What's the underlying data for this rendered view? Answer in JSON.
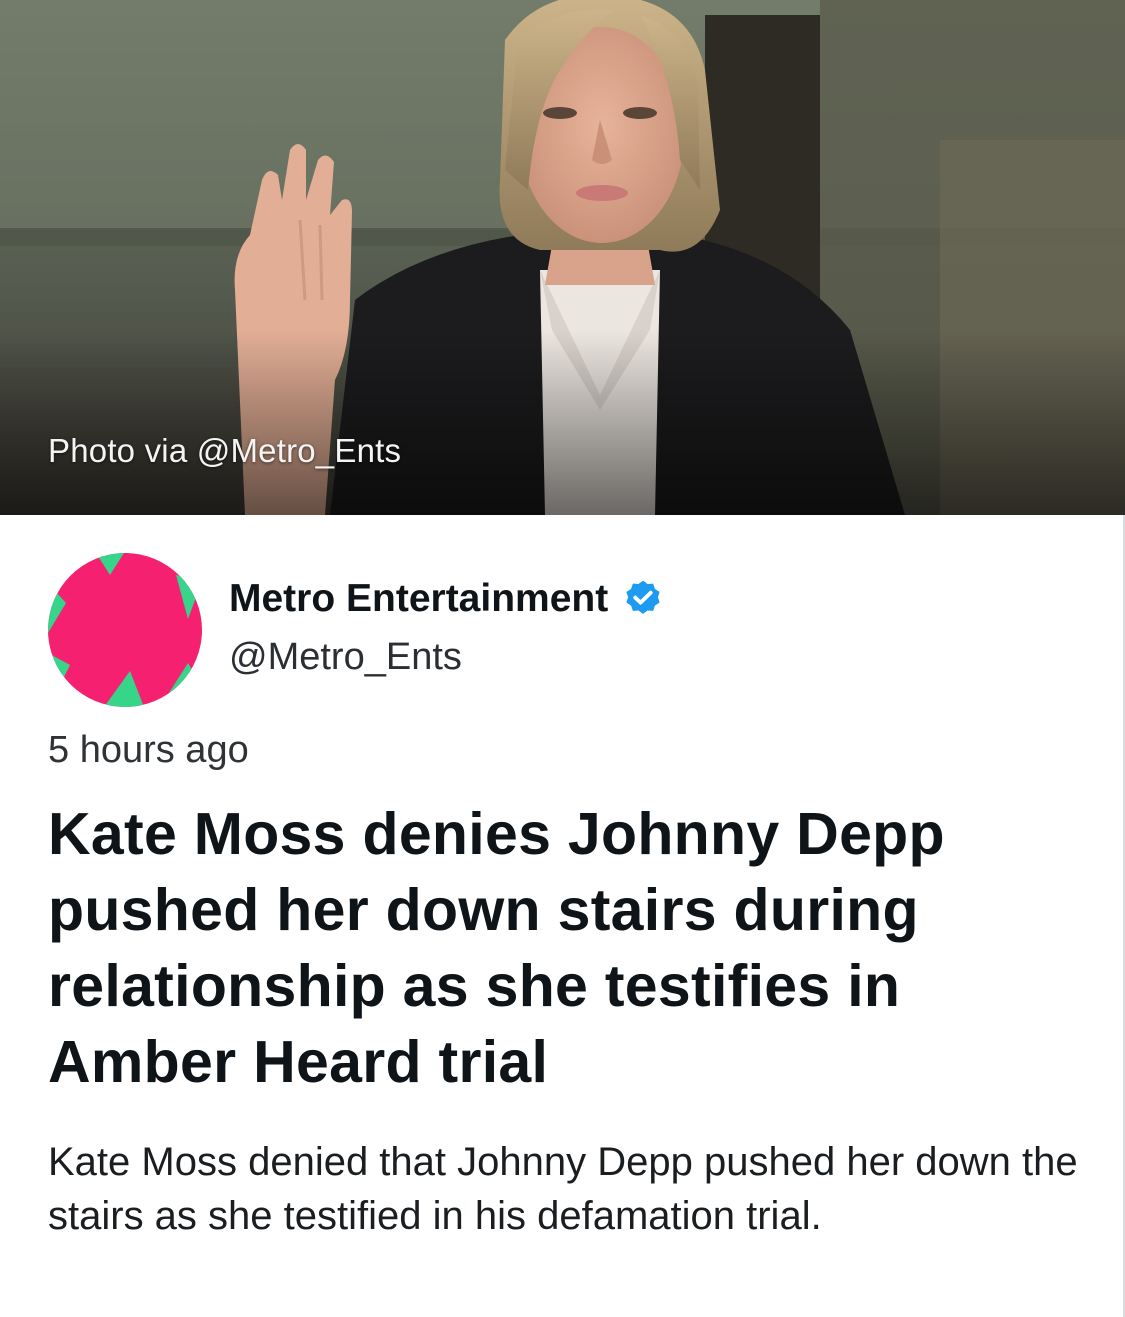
{
  "hero": {
    "caption": "Photo via @Metro_Ents"
  },
  "author": {
    "name": "Metro Entertainment",
    "handle": "@Metro_Ents",
    "verified": true,
    "avatar_colors": {
      "pink": "#f5206f",
      "green": "#36d58a"
    },
    "verified_color": "#1d9bf0"
  },
  "post": {
    "timestamp": "5 hours ago",
    "headline": "Kate Moss denies Johnny Depp pushed her down stairs during relationship as she testifies in Amber Heard trial",
    "summary": "Kate Moss denied that Johnny Depp pushed her down the stairs as she testified in his defamation trial."
  }
}
